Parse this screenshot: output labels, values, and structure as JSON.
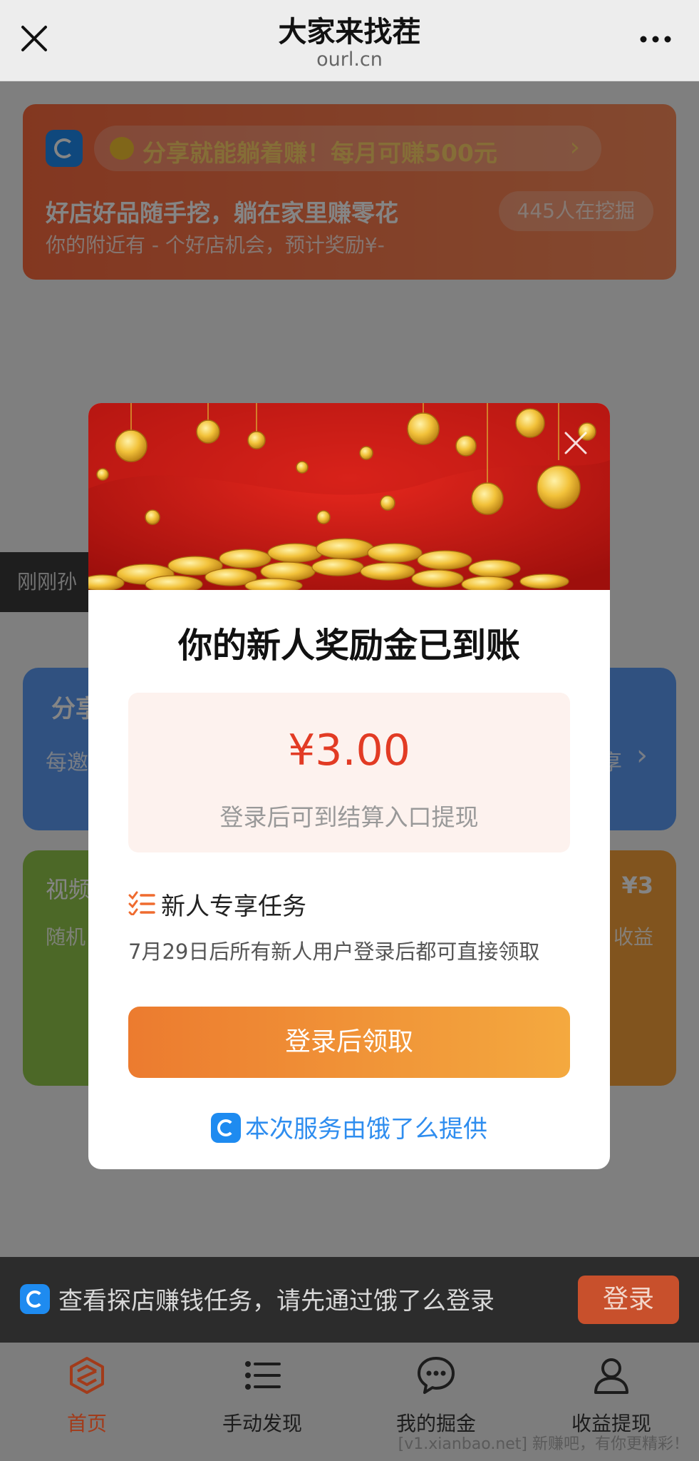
{
  "topbar": {
    "title": "大家来找茬",
    "url": "ourl.cn"
  },
  "promo": {
    "pill_text": "分享就能躺着赚！每月可赚500元",
    "headline": "好店好品随手挖，躺在家里赚零花",
    "sub": "你的附近有 - 个好店机会，预计奖励¥-",
    "count": "445人在挖掘"
  },
  "ticker": {
    "text": "刚刚孙"
  },
  "cards": {
    "blue_title": "分享",
    "blue_sub_left": "每邀",
    "blue_sub_right": "享",
    "green_title": "视频",
    "green_sub": "随机",
    "orange_title": "¥3",
    "orange_sub": "收益"
  },
  "login_bar": {
    "text": "查看探店赚钱任务，请先通过饿了么登录",
    "button": "登录"
  },
  "tabs": [
    {
      "label": "首页",
      "icon": "home-cube-icon"
    },
    {
      "label": "手动发现",
      "icon": "list-icon"
    },
    {
      "label": "我的掘金",
      "icon": "chat-bubble-icon"
    },
    {
      "label": "收益提现",
      "icon": "user-icon"
    }
  ],
  "watermark": "[v1.xianbao.net] 新赚吧，有你更精彩！",
  "modal": {
    "title": "你的新人奖励金已到账",
    "amount": "¥3.00",
    "amount_note": "登录后可到结算入口提现",
    "task_title": "新人专享任务",
    "task_desc": "7月29日后所有新人用户登录后都可直接领取",
    "cta": "登录后领取",
    "powered_by": "本次服务由饿了么提供"
  },
  "colors": {
    "accent_orange": "#f4a93f",
    "amount_red": "#e23b24",
    "brand_blue": "#1e8bf0"
  }
}
